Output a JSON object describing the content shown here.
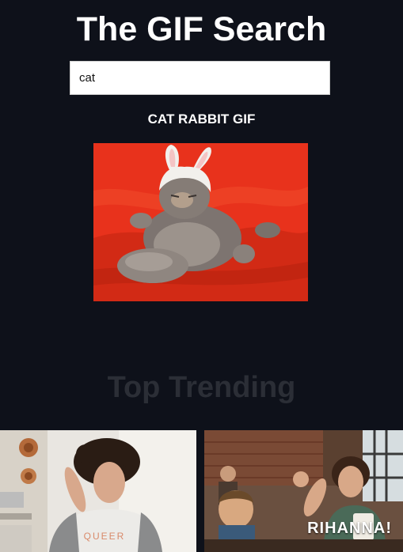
{
  "header": {
    "title": "The GIF Search"
  },
  "search": {
    "value": "cat"
  },
  "result": {
    "title": "CAT RABBIT GIF"
  },
  "trending": {
    "heading": "Top Trending",
    "items": [
      {
        "shirt_text": "QUEER"
      },
      {
        "caption": "RIHANNA!"
      }
    ]
  },
  "colors": {
    "background": "#0e111a",
    "title_text": "#ffffff",
    "trending_heading": "#2b2e36",
    "result_backdrop": "#e8321c"
  },
  "icons": [
    "cat-rabbit-gif-image",
    "trending-gif-image"
  ]
}
